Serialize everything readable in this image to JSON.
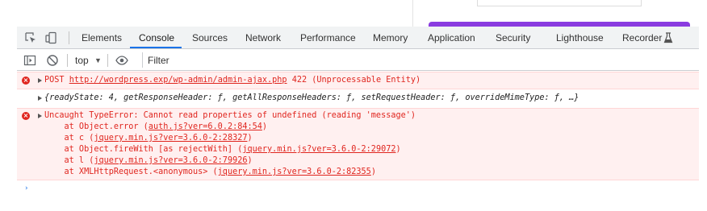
{
  "tabs": [
    {
      "label": "Elements"
    },
    {
      "label": "Console"
    },
    {
      "label": "Sources"
    },
    {
      "label": "Network"
    },
    {
      "label": "Performance"
    },
    {
      "label": "Memory"
    },
    {
      "label": "Application"
    },
    {
      "label": "Security"
    },
    {
      "label": "Lighthouse"
    },
    {
      "label": "Recorder"
    }
  ],
  "active_tab": "Console",
  "toolbar": {
    "context": "top",
    "filter_placeholder": "Filter"
  },
  "colors": {
    "error_text": "#e0261f",
    "error_bg": "#fff0f0",
    "active_tab_underline": "#1a73e8",
    "page_button": "#8a3ce0"
  },
  "console": {
    "post_error": {
      "method": "POST",
      "url": "http://wordpress.exp/wp-admin/admin-ajax.php",
      "status": "422 (Unprocessable Entity)"
    },
    "object_line": "{readyState: 4, getResponseHeader: ƒ, getAllResponseHeaders: ƒ, setRequestHeader: ƒ, overrideMimeType: ƒ, …}",
    "type_error": {
      "message": "Uncaught TypeError: Cannot read properties of undefined (reading 'message')",
      "stack": [
        {
          "prefix": "    at Object.error (",
          "link": "auth.js?ver=6.0.2:84:54",
          "suffix": ")"
        },
        {
          "prefix": "    at c (",
          "link": "jquery.min.js?ver=3.6.0-2:28327",
          "suffix": ")"
        },
        {
          "prefix": "    at Object.fireWith [as rejectWith] (",
          "link": "jquery.min.js?ver=3.6.0-2:29072",
          "suffix": ")"
        },
        {
          "prefix": "    at l (",
          "link": "jquery.min.js?ver=3.6.0-2:79926",
          "suffix": ")"
        },
        {
          "prefix": "    at XMLHttpRequest.<anonymous> (",
          "link": "jquery.min.js?ver=3.6.0-2:82355",
          "suffix": ")"
        }
      ]
    }
  }
}
